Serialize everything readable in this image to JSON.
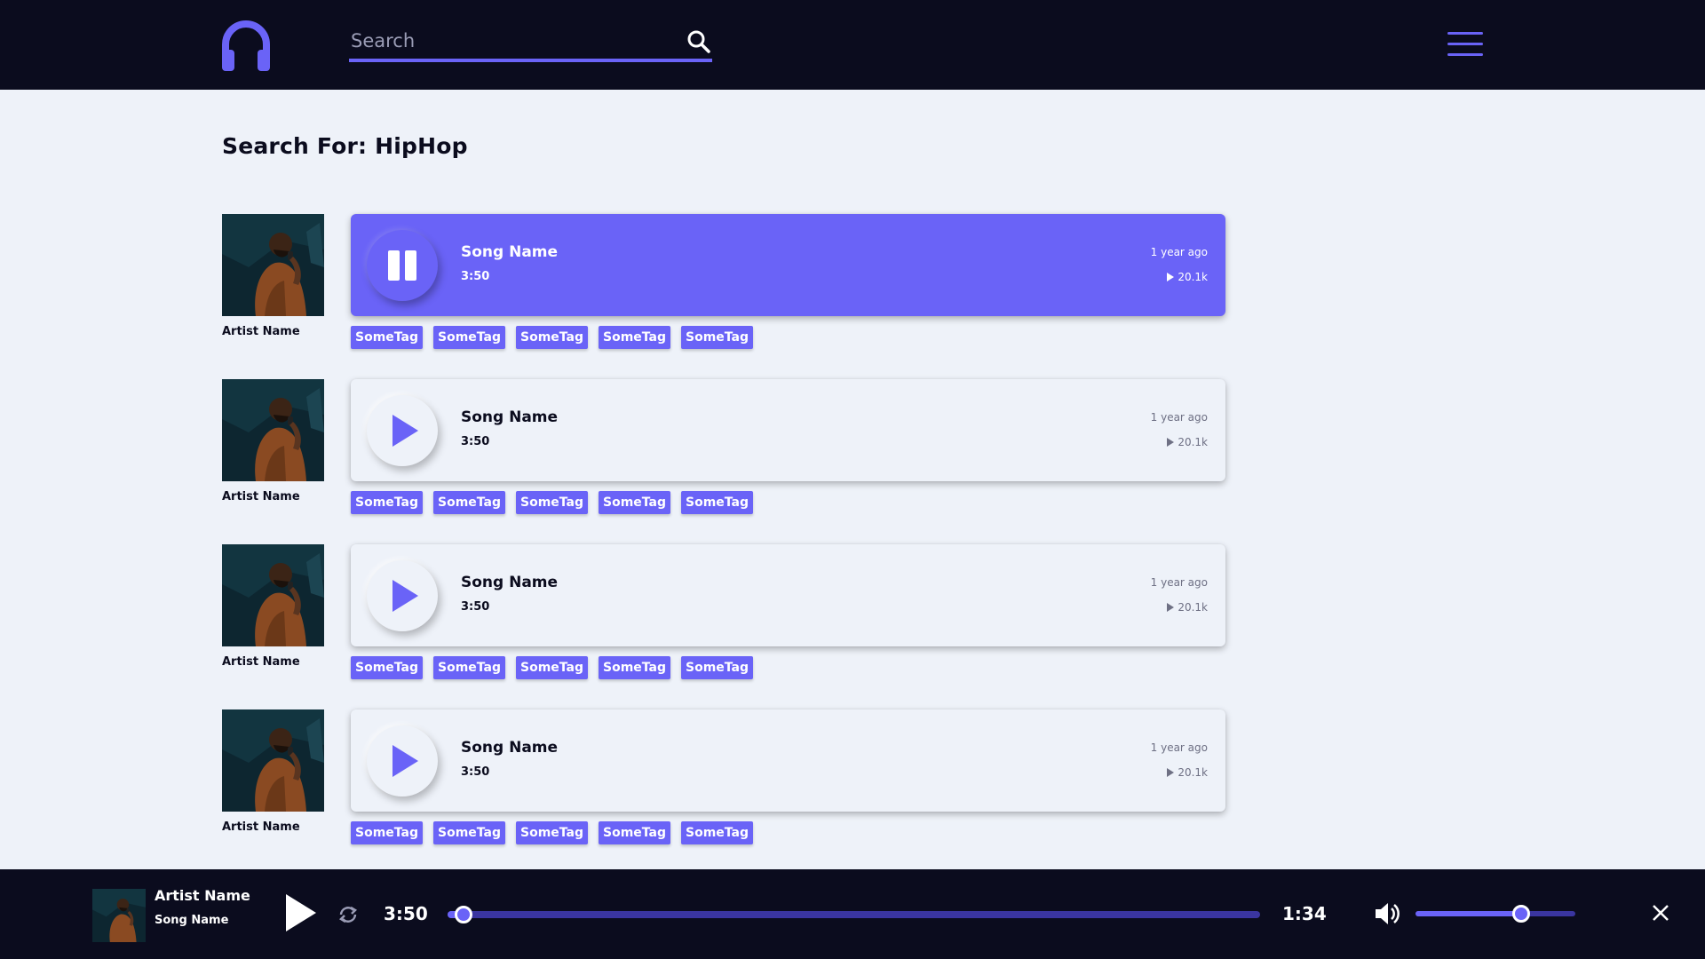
{
  "header": {
    "search": {
      "placeholder": "Search",
      "value": ""
    },
    "icons": {
      "logo": "headphones-icon",
      "search": "search-icon",
      "menu": "hamburger-menu-icon"
    }
  },
  "page": {
    "title": "Search For: HipHop"
  },
  "results": [
    {
      "artist": "Artist Name",
      "song": "Song Name",
      "duration": "3:50",
      "age": "1 year ago",
      "plays": "20.1k",
      "state": "playing",
      "state_icon": "pause-icon",
      "tags": [
        "SomeTag",
        "SomeTag",
        "SomeTag",
        "SomeTag",
        "SomeTag"
      ]
    },
    {
      "artist": "Artist Name",
      "song": "Song Name",
      "duration": "3:50",
      "age": "1 year ago",
      "plays": "20.1k",
      "state": "paused",
      "state_icon": "play-icon",
      "tags": [
        "SomeTag",
        "SomeTag",
        "SomeTag",
        "SomeTag",
        "SomeTag"
      ]
    },
    {
      "artist": "Artist Name",
      "song": "Song Name",
      "duration": "3:50",
      "age": "1 year ago",
      "plays": "20.1k",
      "state": "paused",
      "state_icon": "play-icon",
      "tags": [
        "SomeTag",
        "SomeTag",
        "SomeTag",
        "SomeTag",
        "SomeTag"
      ]
    },
    {
      "artist": "Artist Name",
      "song": "Song Name",
      "duration": "3:50",
      "age": "1 year ago",
      "plays": "20.1k",
      "state": "paused",
      "state_icon": "play-icon",
      "tags": [
        "SomeTag",
        "SomeTag",
        "SomeTag",
        "SomeTag",
        "SomeTag"
      ]
    }
  ],
  "player": {
    "artist": "Artist Name",
    "song": "Song Name",
    "current_time": "3:50",
    "total_time": "1:34",
    "progress": 0.02,
    "volume": 0.66,
    "icons": {
      "play": "play-icon",
      "repeat": "repeat-icon",
      "volume": "volume-icon",
      "close": "close-icon"
    }
  },
  "colors": {
    "accent": "#6a63f7",
    "dark": "#0b0c1e",
    "background": "#eef2f9",
    "muted": "#6e7084"
  }
}
